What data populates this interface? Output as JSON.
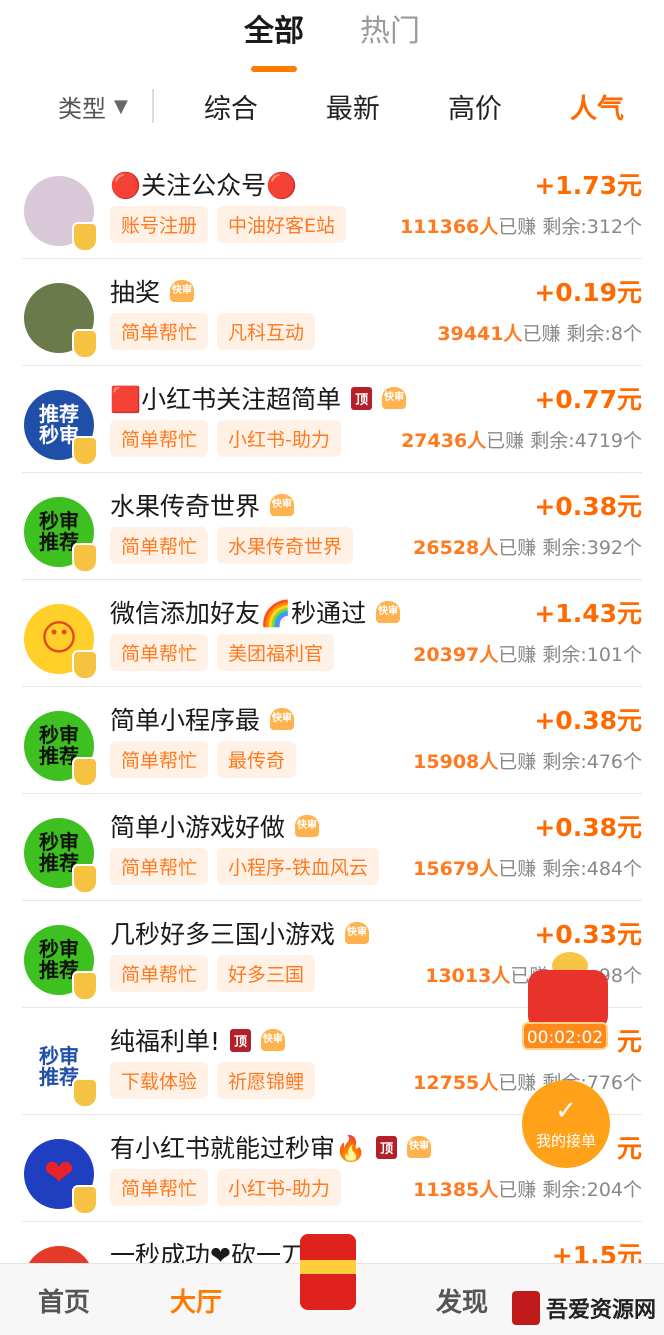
{
  "top_tabs": [
    {
      "label": "全部",
      "active": true
    },
    {
      "label": "热门",
      "active": false
    }
  ],
  "filter": {
    "type_label": "类型",
    "sort": [
      {
        "label": "综合",
        "active": false
      },
      {
        "label": "最新",
        "active": false
      },
      {
        "label": "高价",
        "active": false
      },
      {
        "label": "人气",
        "active": true
      }
    ]
  },
  "colors": {
    "accent": "#ff6a00",
    "chip_bg": "#fff1e6",
    "top_badge": "#b4202a"
  },
  "tasks": [
    {
      "title": "🔴关注公众号🔴",
      "reward": "+1.73元",
      "tags": [
        "账号注册",
        "中油好客E站"
      ],
      "earned": "111366人",
      "earned_suffix": "已赚",
      "remaining": "剩余:312个",
      "top": false,
      "fast": false,
      "avatar": {
        "kind": "photo",
        "text": "",
        "bg": "#d9c8d8"
      }
    },
    {
      "title": "抽奖",
      "reward": "+0.19元",
      "tags": [
        "简单帮忙",
        "凡科互动"
      ],
      "earned": "39441人",
      "earned_suffix": "已赚",
      "remaining": "剩余:8个",
      "top": false,
      "fast": true,
      "avatar": {
        "kind": "photo",
        "text": "",
        "bg": "#6a7a4a"
      }
    },
    {
      "title": "🟥小红书关注超简单",
      "reward": "+0.77元",
      "tags": [
        "简单帮忙",
        "小红书-助力"
      ],
      "earned": "27436人",
      "earned_suffix": "已赚",
      "remaining": "剩余:4719个",
      "top": true,
      "fast": true,
      "avatar": {
        "kind": "text",
        "text": "推荐秒审",
        "bg": "#1f4fa8",
        "color": "#ffffff"
      }
    },
    {
      "title": "水果传奇世界",
      "reward": "+0.38元",
      "tags": [
        "简单帮忙",
        "水果传奇世界"
      ],
      "earned": "26528人",
      "earned_suffix": "已赚",
      "remaining": "剩余:392个",
      "top": false,
      "fast": true,
      "avatar": {
        "kind": "text",
        "text": "秒审推荐",
        "bg": "#3ec021",
        "color": "#111111"
      }
    },
    {
      "title": "微信添加好友🌈秒通过",
      "reward": "+1.43元",
      "tags": [
        "简单帮忙",
        "美团福利官"
      ],
      "earned": "20397人",
      "earned_suffix": "已赚",
      "remaining": "剩余:101个",
      "top": false,
      "fast": true,
      "avatar": {
        "kind": "emoji",
        "text": "😶",
        "bg": "#ffcf2a",
        "color": "#e24a1a"
      }
    },
    {
      "title": "简单小程序最",
      "reward": "+0.38元",
      "tags": [
        "简单帮忙",
        "最传奇"
      ],
      "earned": "15908人",
      "earned_suffix": "已赚",
      "remaining": "剩余:476个",
      "top": false,
      "fast": true,
      "avatar": {
        "kind": "text",
        "text": "秒审推荐",
        "bg": "#3ec021",
        "color": "#111111"
      }
    },
    {
      "title": "简单小游戏好做",
      "reward": "+0.38元",
      "tags": [
        "简单帮忙",
        "小程序-铁血风云"
      ],
      "earned": "15679人",
      "earned_suffix": "已赚",
      "remaining": "剩余:484个",
      "top": false,
      "fast": true,
      "avatar": {
        "kind": "text",
        "text": "秒审推荐",
        "bg": "#3ec021",
        "color": "#111111"
      }
    },
    {
      "title": "几秒好多三国小游戏",
      "reward": "+0.33元",
      "tags": [
        "简单帮忙",
        "好多三国"
      ],
      "earned": "13013人",
      "earned_suffix": "已赚",
      "remaining": "剩余:98个",
      "top": false,
      "fast": true,
      "avatar": {
        "kind": "text",
        "text": "秒审推荐",
        "bg": "#3ec021",
        "color": "#111111"
      }
    },
    {
      "title": "纯福利单!",
      "reward": "元",
      "tags": [
        "下载体验",
        "祈愿锦鲤"
      ],
      "earned": "12755人",
      "earned_suffix": "已赚",
      "remaining": "剩余:776个",
      "top": true,
      "fast": true,
      "avatar": {
        "kind": "text",
        "text": "秒审推荐",
        "bg": "#ffffff",
        "color": "#1f4fa8"
      }
    },
    {
      "title": "有小红书就能过秒审🔥",
      "reward": "元",
      "tags": [
        "简单帮忙",
        "小红书-助力"
      ],
      "earned": "11385人",
      "earned_suffix": "已赚",
      "remaining": "剩余:204个",
      "top": true,
      "fast": true,
      "avatar": {
        "kind": "emoji",
        "text": "❤",
        "bg": "#1f3fc0",
        "color": "#e8222a"
      }
    },
    {
      "title": "一秒成功❤砍一刀",
      "reward": "+1.5元",
      "tags": [],
      "earned": "",
      "earned_suffix": "",
      "remaining": "",
      "top": false,
      "fast": false,
      "avatar": {
        "kind": "text",
        "text": "",
        "bg": "#e43a2a",
        "color": "#ffffff"
      }
    }
  ],
  "float_timer": "00:02:02",
  "float_myorders": {
    "label": "我的接单",
    "icon": "document-check-icon"
  },
  "bottom_nav": [
    {
      "label": "首页",
      "active": false
    },
    {
      "label": "大厅",
      "active": true
    },
    {
      "label": "发现",
      "active": false
    }
  ],
  "watermark": "吾爱资源网",
  "badges": {
    "top_text": "顶",
    "fast_text": "快审"
  }
}
